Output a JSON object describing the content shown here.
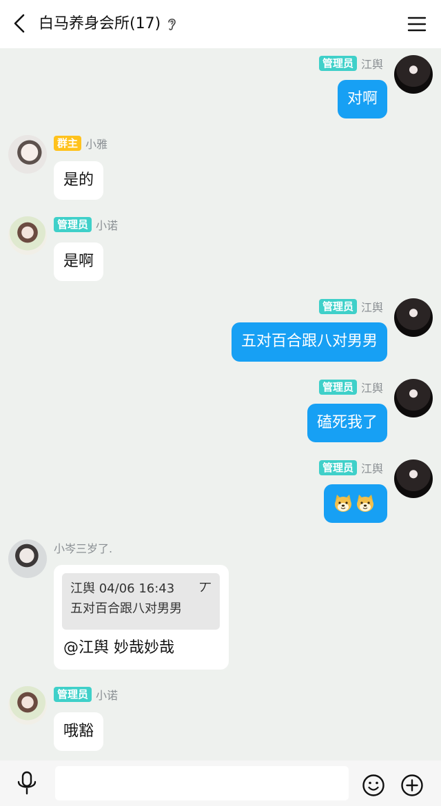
{
  "header": {
    "title": "白马养身会所(17)",
    "icons": {
      "back": "chevron-left-icon",
      "ear": "ear-icon",
      "menu": "hamburger-menu-icon"
    }
  },
  "colors": {
    "outgoing_bubble": "#17a0f4",
    "incoming_bubble": "#ffffff",
    "admin_badge": "#3fd0c9",
    "owner_badge": "#ffc21d",
    "background": "#eef1ee"
  },
  "messages": [
    {
      "direction": "out",
      "badge": "管理员",
      "sender": "江舆",
      "text": "对啊"
    },
    {
      "direction": "in",
      "badge": "群主",
      "sender": "小雅",
      "text": "是的"
    },
    {
      "direction": "in",
      "badge": "管理员",
      "sender": "小诺",
      "text": "是啊"
    },
    {
      "direction": "out",
      "badge": "管理员",
      "sender": "江舆",
      "text": "五对百合跟八对男男"
    },
    {
      "direction": "out",
      "badge": "管理员",
      "sender": "江舆",
      "text": "磕死我了"
    },
    {
      "direction": "out",
      "badge": "管理员",
      "sender": "江舆",
      "emojis": [
        "doge-icon",
        "doge-icon"
      ]
    },
    {
      "direction": "in",
      "badge": "",
      "sender": "小岑三岁了.",
      "quote": {
        "author_time": "江舆 04/06 16:43",
        "text": "五对百合跟八对男男",
        "close": "丆"
      },
      "text": "@江舆 妙哉妙哉"
    },
    {
      "direction": "in",
      "badge": "管理员",
      "sender": "小诺",
      "text": "哦豁"
    }
  ],
  "bottombar": {
    "input_value": "",
    "input_placeholder": "",
    "icons": {
      "mic": "microphone-icon",
      "emoji": "smiley-icon",
      "plus": "plus-icon"
    }
  }
}
